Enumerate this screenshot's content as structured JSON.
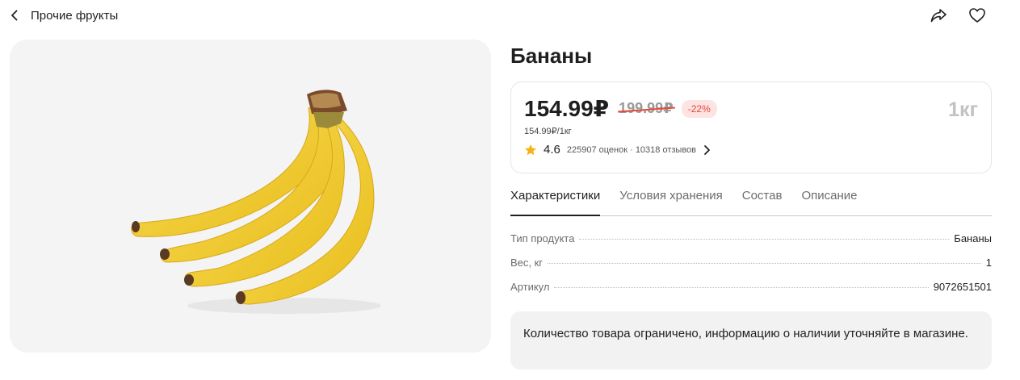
{
  "header": {
    "back_label": "Прочие фрукты",
    "icons": [
      "back-arrow-icon",
      "share-icon",
      "heart-icon"
    ]
  },
  "product": {
    "title": "Бананы",
    "price": "154.99₽",
    "old_price": "199.99₽",
    "discount": "-22%",
    "unit_price": "154.99₽/1кг",
    "weight": "1кг",
    "rating": "4.6",
    "rating_meta": "225907 оценок · 10318 отзывов",
    "image_alt": "Бананы"
  },
  "tabs": [
    {
      "label": "Характеристики",
      "active": true
    },
    {
      "label": "Условия хранения",
      "active": false
    },
    {
      "label": "Состав",
      "active": false
    },
    {
      "label": "Описание",
      "active": false
    }
  ],
  "specs": [
    {
      "key": "Тип продукта",
      "value": "Бананы"
    },
    {
      "key": "Вес, кг",
      "value": "1"
    },
    {
      "key": "Артикул",
      "value": "9072651501"
    }
  ],
  "notice": "Количество товара ограничено, информацию о наличии уточняйте в магазине.",
  "colors": {
    "accent_discount": "#e3493a",
    "discount_bg": "#fde3e1",
    "star": "#f5b316",
    "photo_bg": "#f4f4f4"
  }
}
